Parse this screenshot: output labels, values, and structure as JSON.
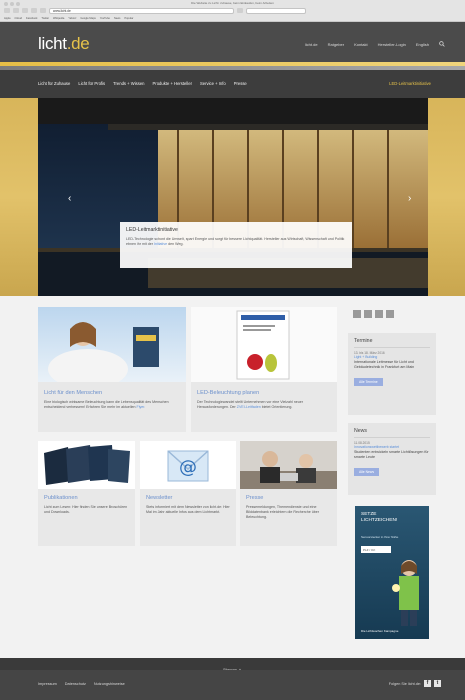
{
  "browser": {
    "title": "Die Website zu Licht: zuhause, beim Einkaufen, beim Arbeiten",
    "url": "www.licht.de",
    "bookmarks": [
      "Apple",
      "iCloud",
      "Facebook",
      "Twitter",
      "Wikipedia",
      "Yahoo!",
      "Google Maps",
      "YouTube",
      "News",
      "Popular"
    ]
  },
  "header": {
    "logo_main": "licht",
    "logo_domain": ".de",
    "util_nav": [
      "licht.de",
      "Ratgeber",
      "Kontakt",
      "Hersteller-Login",
      "English"
    ]
  },
  "main_nav": {
    "items": [
      "Licht für Zuhause",
      "Licht für Profis",
      "Trends + Wissen",
      "Produkte + Hersteller",
      "Service + Info",
      "Presse"
    ],
    "cta": "LED-Leitmarktinitiative"
  },
  "hero": {
    "caption_title": "LED-Leitmarktinitiative",
    "caption_text": "LED-Technologie schont die Umwelt, spart Energie und sorgt für bessere Lichtqualität. Hersteller aus Wirtschaft, Wissenschaft und Politik ebnen ihr mit der",
    "caption_link": "Initiative",
    "caption_end": "den Weg."
  },
  "cards": [
    {
      "title": "Licht für den Menschen",
      "text": "Eine biologisch wirksame Beleuchtung kann die Lebensqualität des Menschen entscheidend verbessern! Erfahren Sie mehr im aktuellen",
      "link": "Flyer."
    },
    {
      "title": "LED-Beleuchtung planen",
      "text": "Der Technologiewandel stellt Unternehmen vor eine Vielzahl neuer Herausforderungen. Der",
      "link": "ZVEI-Leitfaden",
      "text_end": "bietet Orientierung."
    },
    {
      "title": "Publikationen",
      "text": "Licht zum Lesen: Hier finden Sie unsere Broschüren und Downloads."
    },
    {
      "title": "Newsletter",
      "text": "Stets informiert mit dem Newsletter von licht.de: Hier Mal im Jahr aktuelle Infos aus dem Lichtmarkt."
    },
    {
      "title": "Presse",
      "text": "Pressemeldungen, Themendienste und eine Bilddatenbank erleichtern die Recherche über Beleuchtung."
    }
  ],
  "sidebar": {
    "termine": {
      "title": "Termine",
      "date": "13. bis 18. März 2016",
      "event": "Light + Building",
      "desc": "Internationale Leitmesse für Licht und Gebäudetechnik in Frankfurt am Main",
      "button": "Alle Termine"
    },
    "news": {
      "title": "News",
      "date": "11.08.2015",
      "event": "Innovationswettbewerb startet",
      "desc": "Studenten entwickeln smarte Lichtlösungen für smarte Leute",
      "button": "Alle News"
    },
    "promo": {
      "headline1": "SETZE",
      "headline2": "LICHTZEICHEN!",
      "sub": "Sensorstecker in Ihrer Nähe",
      "plz": "PLZ / Ort",
      "caption": "Die Lichtwochen Kampagne"
    }
  },
  "footer": {
    "sitemap": "Sitemap",
    "links": [
      "Impressum",
      "Datenschutz",
      "Nutzungshinweise"
    ],
    "follow": "Folgen Sie licht.de:"
  }
}
